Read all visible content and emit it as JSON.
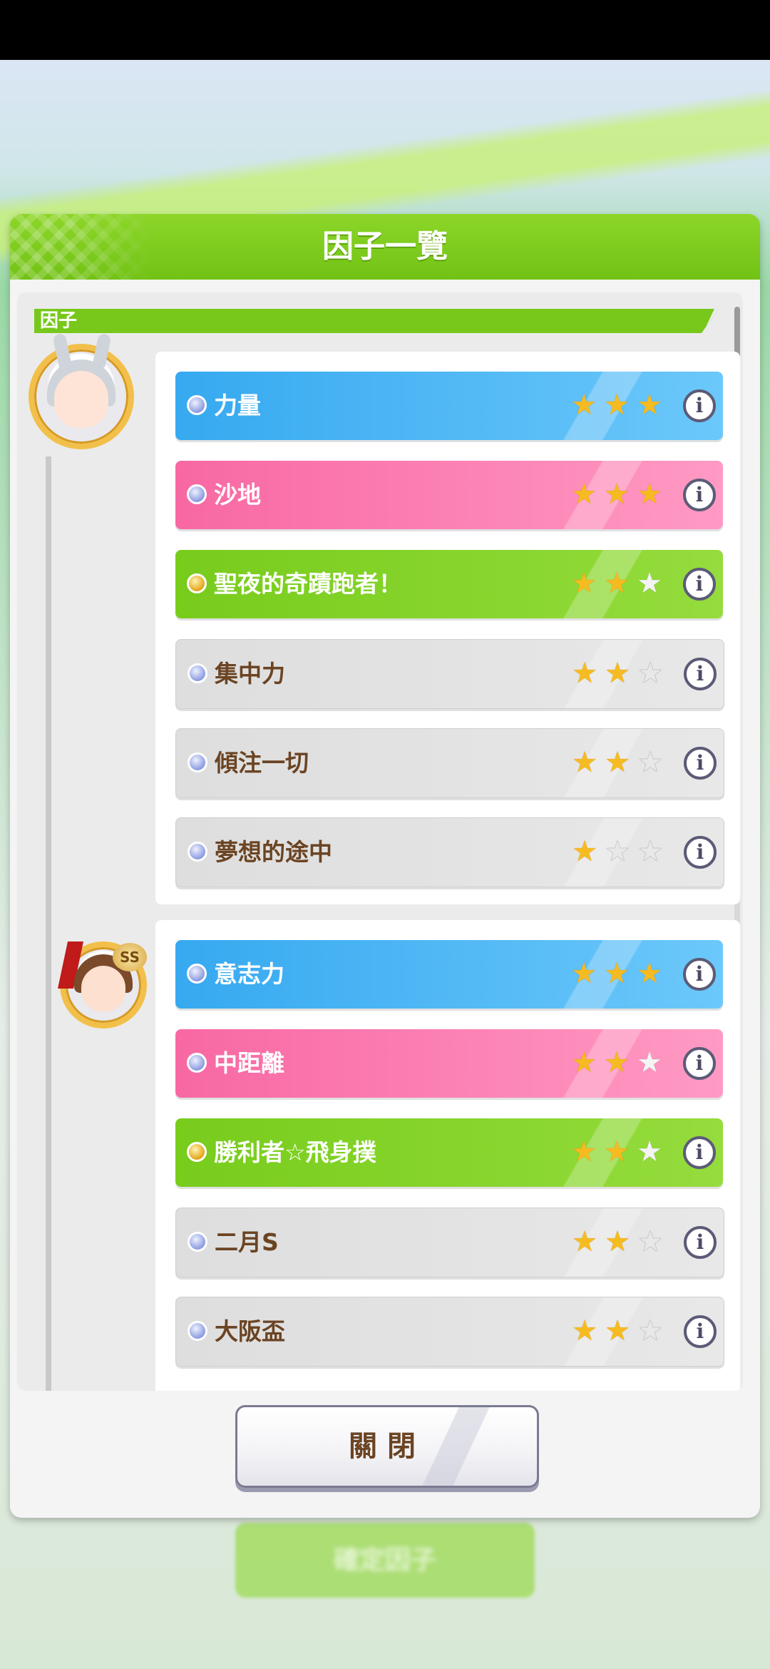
{
  "dialog": {
    "title": "因子一覽",
    "section_label": "因子",
    "close_label": "關閉"
  },
  "background": {
    "confirm_button_label": "確定因子"
  },
  "groups": [
    {
      "avatar": "character-portrait-silver-hair",
      "factors": [
        {
          "name": "力量",
          "color": "blue",
          "dot": "silver",
          "stars": 3
        },
        {
          "name": "沙地",
          "color": "pink",
          "dot": "silver",
          "stars": 3
        },
        {
          "name": "聖夜的奇蹟跑者！",
          "color": "green",
          "dot": "gold",
          "stars": 2
        },
        {
          "name": "集中力",
          "color": "gray",
          "dot": "silver",
          "stars": 2
        },
        {
          "name": "傾注一切",
          "color": "gray",
          "dot": "silver",
          "stars": 2
        },
        {
          "name": "夢想的途中",
          "color": "gray",
          "dot": "silver",
          "stars": 1
        }
      ]
    },
    {
      "avatar": "character-portrait-brown-hair",
      "badge": "SS",
      "factors": [
        {
          "name": "意志力",
          "color": "blue",
          "dot": "silver",
          "stars": 3
        },
        {
          "name": "中距離",
          "color": "pink",
          "dot": "silver",
          "stars": 2
        },
        {
          "name": "勝利者☆飛身撲",
          "color": "green",
          "dot": "gold",
          "stars": 2
        },
        {
          "name": "二月S",
          "color": "gray",
          "dot": "silver",
          "stars": 2
        },
        {
          "name": "大阪盃",
          "color": "gray",
          "dot": "silver",
          "stars": 2
        }
      ]
    }
  ],
  "icons": {
    "star": "star-icon",
    "info": "info-icon"
  },
  "colors": {
    "header_green": "#7ccb1e",
    "blue_factor": "#4ab8f4",
    "pink_factor": "#fb7fb1",
    "green_factor": "#84d22a",
    "gray_factor": "#e2e2e2",
    "star_gold": "#f6bb20"
  }
}
